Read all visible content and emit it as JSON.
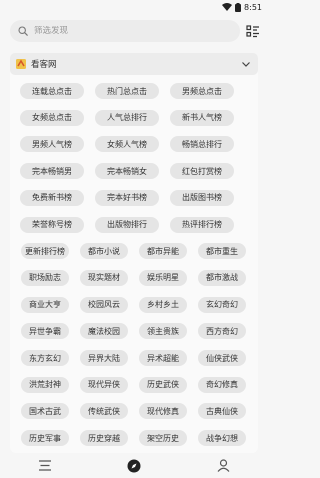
{
  "status_bar": {
    "time": "8:51"
  },
  "search": {
    "placeholder": "筛选发现"
  },
  "panel": {
    "title": "看客网",
    "tags": [
      [
        "连载总点击",
        "热门总点击",
        "男频总点击"
      ],
      [
        "女频总点击",
        "人气总排行",
        "新书人气榜"
      ],
      [
        "男频人气榜",
        "女频人气榜",
        "畅销总排行"
      ],
      [
        "完本畅销男",
        "完本畅销女",
        "红包打赏榜"
      ],
      [
        "免费新书榜",
        "完本好书榜",
        "出版图书榜"
      ],
      [
        "荣誉称号榜",
        "出版物排行",
        "热评排行榜"
      ],
      [
        "更新排行榜",
        "都市小说",
        "都市异能",
        "都市重生"
      ],
      [
        "职场励志",
        "现实题材",
        "娱乐明星",
        "都市激战"
      ],
      [
        "商业大亨",
        "校园风云",
        "乡村乡土",
        "玄幻奇幻"
      ],
      [
        "异世争霸",
        "魔法校园",
        "领主贵族",
        "西方奇幻"
      ],
      [
        "东方玄幻",
        "异界大陆",
        "异术超能",
        "仙侠武侠"
      ],
      [
        "洪荒封神",
        "现代异侠",
        "历史武侠",
        "奇幻修真"
      ],
      [
        "国术古武",
        "传统武侠",
        "现代修真",
        "古典仙侠"
      ],
      [
        "历史军事",
        "历史穿越",
        "架空历史",
        "战争幻想"
      ]
    ]
  },
  "icons": {
    "wifi": "wifi-icon",
    "battery": "battery-icon",
    "search": "search-icon",
    "filter": "filter-icon",
    "site_logo": "site-logo-icon",
    "chevron": "chevron-down-icon",
    "nav_bookshelf": "bookshelf-icon",
    "nav_discover": "compass-icon",
    "nav_profile": "person-icon"
  }
}
